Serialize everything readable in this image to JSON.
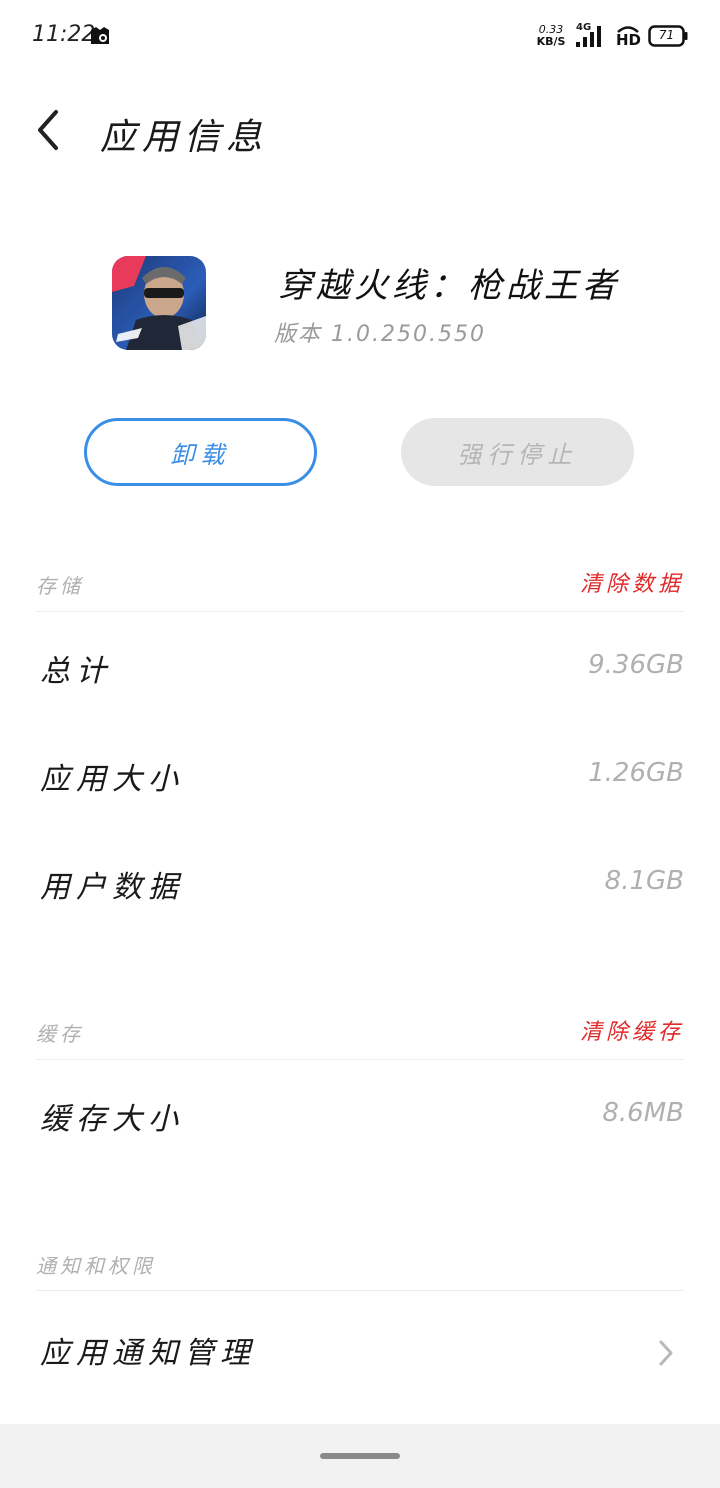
{
  "status_bar": {
    "time": "11:22",
    "net_speed_value": "0.33",
    "net_speed_unit": "KB/S",
    "network_type": "4G",
    "hd_label": "HD",
    "battery": "71"
  },
  "toolbar": {
    "title": "应用信息"
  },
  "app": {
    "name": "穿越火线：枪战王者",
    "version": "版本 1.0.250.550"
  },
  "actions": {
    "uninstall_label": "卸载",
    "force_stop_label": "强行停止"
  },
  "storage": {
    "title": "存储",
    "action": "清除数据",
    "rows": [
      {
        "label": "总计",
        "value": "9.36GB"
      },
      {
        "label": "应用大小",
        "value": "1.26GB"
      },
      {
        "label": "用户数据",
        "value": "8.1GB"
      }
    ]
  },
  "cache": {
    "title": "缓存",
    "action": "清除缓存",
    "rows": [
      {
        "label": "缓存大小",
        "value": "8.6MB"
      }
    ]
  },
  "notifications": {
    "title": "通知和权限",
    "rows": [
      {
        "label": "应用通知管理"
      }
    ]
  },
  "colors": {
    "accent": "#3a8ee6",
    "danger": "#e02a2a",
    "muted": "#b0b0b0",
    "disabled_bg": "#e6e6e6"
  }
}
